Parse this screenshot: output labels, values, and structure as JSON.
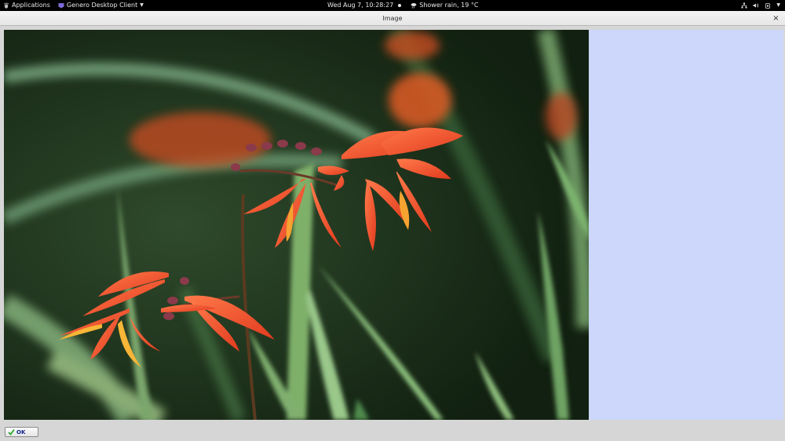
{
  "topbar": {
    "applications": "Applications",
    "app_menu": "Genero Desktop Client",
    "clock": "Wed Aug  7, 10:28:27",
    "weather": "Shower rain, 19 °C"
  },
  "window": {
    "title": "Image",
    "close_glyph": "×"
  },
  "dialog": {
    "ok_label": "OK"
  },
  "icons": {
    "activities": "gnome-foot-icon",
    "app": "genero-app-icon",
    "weather": "cloud-rain-icon",
    "network": "network-icon",
    "volume": "volume-icon",
    "power": "power-icon",
    "ok": "checkmark-icon"
  },
  "colors": {
    "side_panel": "#ccd7fb",
    "topbar": "#000000",
    "ok_text": "#12238a"
  }
}
